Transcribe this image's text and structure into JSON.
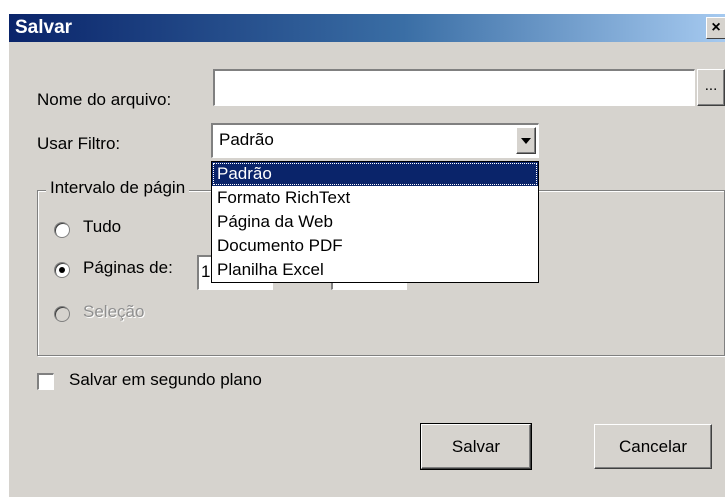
{
  "window": {
    "title": "Salvar",
    "close_glyph": "×"
  },
  "filename": {
    "label": "Nome do arquivo:",
    "value": "",
    "browse_label": "..."
  },
  "filter": {
    "label": "Usar Filtro:",
    "selected": "Padrão",
    "options": [
      "Padrão",
      "Formato RichText",
      "Página da Web",
      "Documento PDF",
      "Planilha Excel"
    ]
  },
  "range": {
    "title": "Intervalo de págin",
    "all_label": "Tudo",
    "pages_label": "Páginas de:",
    "pages_from": "1",
    "pages_to": "",
    "selection_label": "Seleção"
  },
  "background": {
    "label": "Salvar em segundo plano",
    "checked": false
  },
  "buttons": {
    "save": "Salvar",
    "cancel": "Cancelar"
  }
}
